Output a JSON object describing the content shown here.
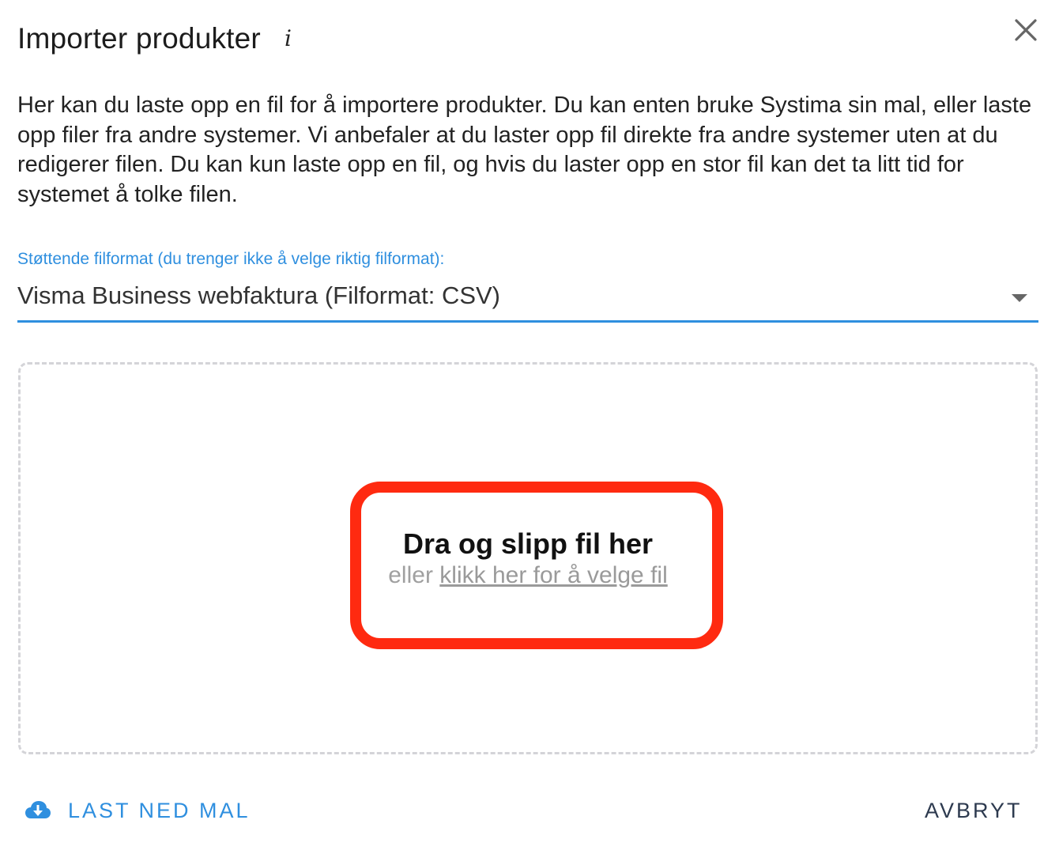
{
  "dialog": {
    "title": "Importer produkter",
    "info_icon": "i",
    "close_icon": "close-icon",
    "description": "Her kan du laste opp en fil for å importere produkter. Du kan enten bruke Systima sin mal, eller laste opp filer fra andre systemer. Vi anbefaler at du laster opp fil direkte fra andre systemer uten at du redigerer filen. Du kan kun laste opp en fil, og hvis du laster opp en stor fil kan det ta litt tid for systemet å tolke filen."
  },
  "format_select": {
    "label": "Støttende filformat (du trenger ikke å velge riktig filformat):",
    "value": "Visma Business webfaktura (Filformat: CSV)",
    "accent_color": "#2f8fdf"
  },
  "dropzone": {
    "title": "Dra og slipp fil her",
    "prefix": "eller",
    "link": "klikk her for å velge fil",
    "highlight_color": "#ff2a10"
  },
  "footer": {
    "download_label": "LAST NED MAL",
    "download_icon": "cloud-download-icon",
    "cancel_label": "AVBRYT"
  }
}
